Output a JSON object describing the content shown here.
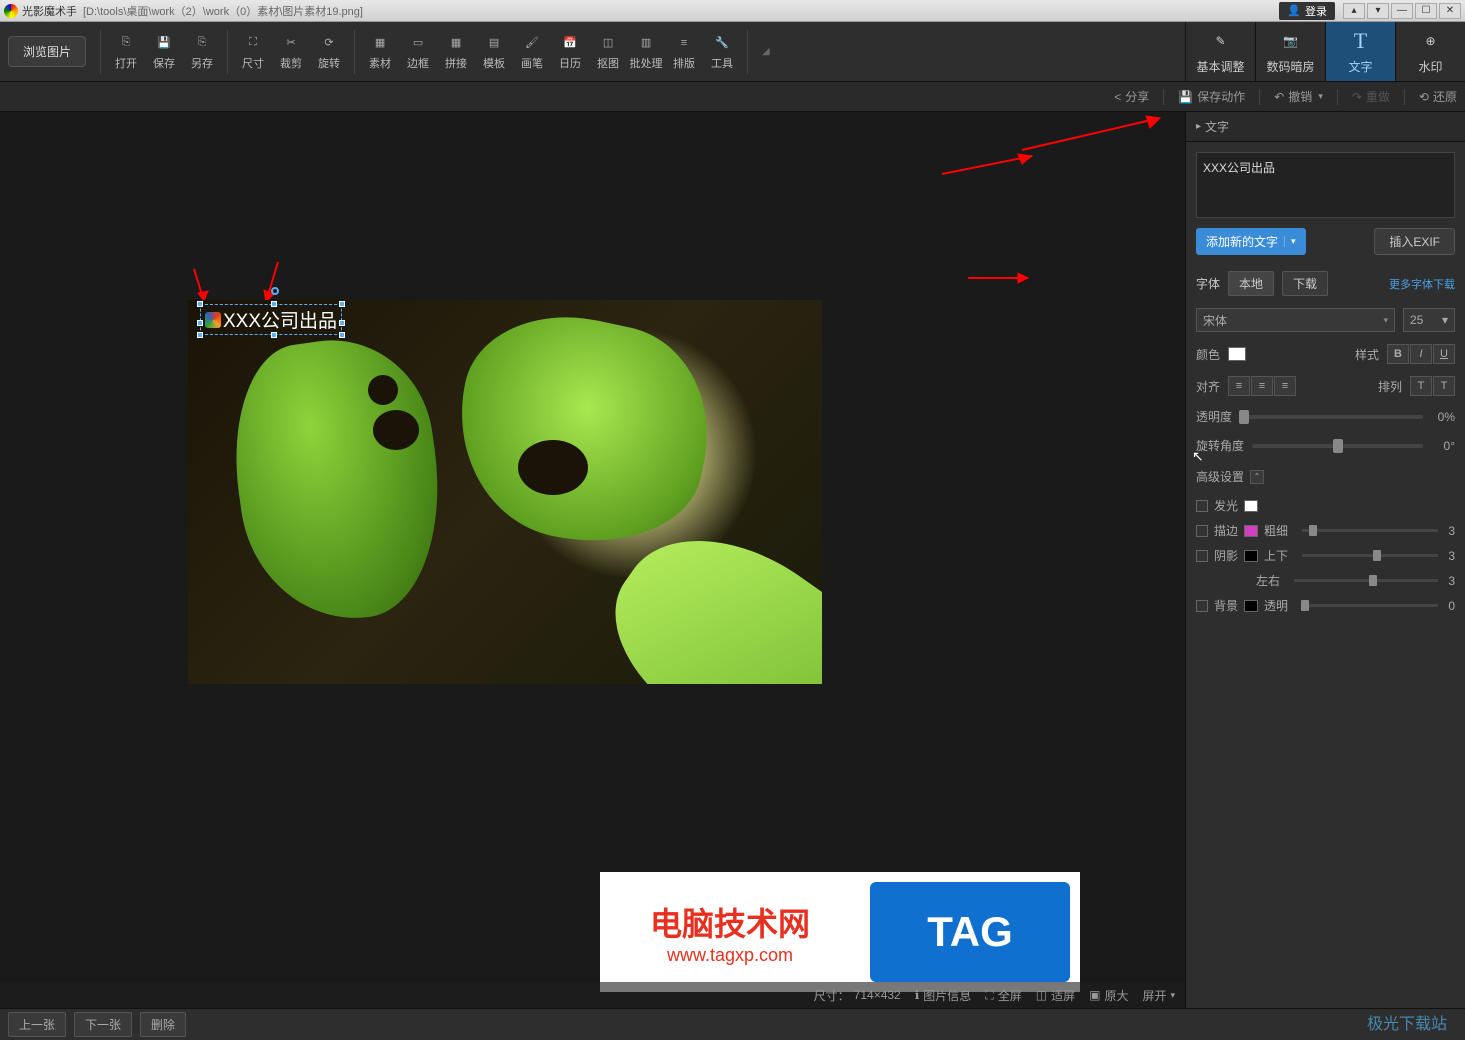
{
  "titlebar": {
    "app_name": "光影魔术手",
    "file_path": "[D:\\tools\\桌面\\work（2）\\work（0）素材\\图片素材19.png]",
    "login": "登录"
  },
  "topbar": {
    "browse": "浏览图片",
    "tools": {
      "open": "打开",
      "save": "保存",
      "saveas": "另存",
      "dimension": "尺寸",
      "crop": "裁剪",
      "rotate": "旋转",
      "material": "素材",
      "border": "边框",
      "collage": "拼接",
      "template": "模板",
      "brush": "画笔",
      "calendar": "日历",
      "cutout": "抠图",
      "batch": "批处理",
      "layout": "排版",
      "tools_label": "工具"
    },
    "right_tabs": {
      "basic": "基本调整",
      "darkroom": "数码暗房",
      "text": "文字",
      "watermark": "水印"
    }
  },
  "subbar": {
    "share": "分享",
    "save_action": "保存动作",
    "undo": "撤销",
    "redo": "重做",
    "restore": "还原"
  },
  "canvas": {
    "text_overlay": "XXX公司出品"
  },
  "right_panel": {
    "header": "文字",
    "text_value": "XXX公司出品",
    "add_new": "添加新的文字",
    "insert_exif": "插入EXIF",
    "font_label": "字体",
    "tab_local": "本地",
    "tab_download": "下载",
    "more_fonts": "更多字体下载",
    "font_name": "宋体",
    "font_size": "25",
    "color_label": "颜色",
    "style_label": "样式",
    "align_label": "对齐",
    "arrange_label": "排列",
    "opacity_label": "透明度",
    "opacity_value": "0%",
    "rotation_label": "旋转角度",
    "rotation_value": "0°",
    "advanced_label": "高级设置",
    "glow_label": "发光",
    "stroke_label": "描边",
    "thickness_label": "粗细",
    "thickness_value": "3",
    "shadow_label": "阴影",
    "vertical_label": "上下",
    "vertical_value": "3",
    "horizontal_label": "左右",
    "horizontal_value": "3",
    "bg_label": "背景",
    "transparent_label": "透明",
    "transparent_value": "0"
  },
  "statusbar": {
    "size_label": "尺寸：",
    "size_value": "714×432",
    "image_info": "图片信息",
    "fullscreen": "全屏",
    "fit": "适屏",
    "original": "原大",
    "zoom": "屏开"
  },
  "bottombar": {
    "prev": "上一张",
    "next": "下一张",
    "delete": "删除"
  },
  "watermark": {
    "line1": "电脑技术网",
    "line2": "www.tagxp.com",
    "tag": "TAG"
  },
  "footer_wm": "极光下载站"
}
